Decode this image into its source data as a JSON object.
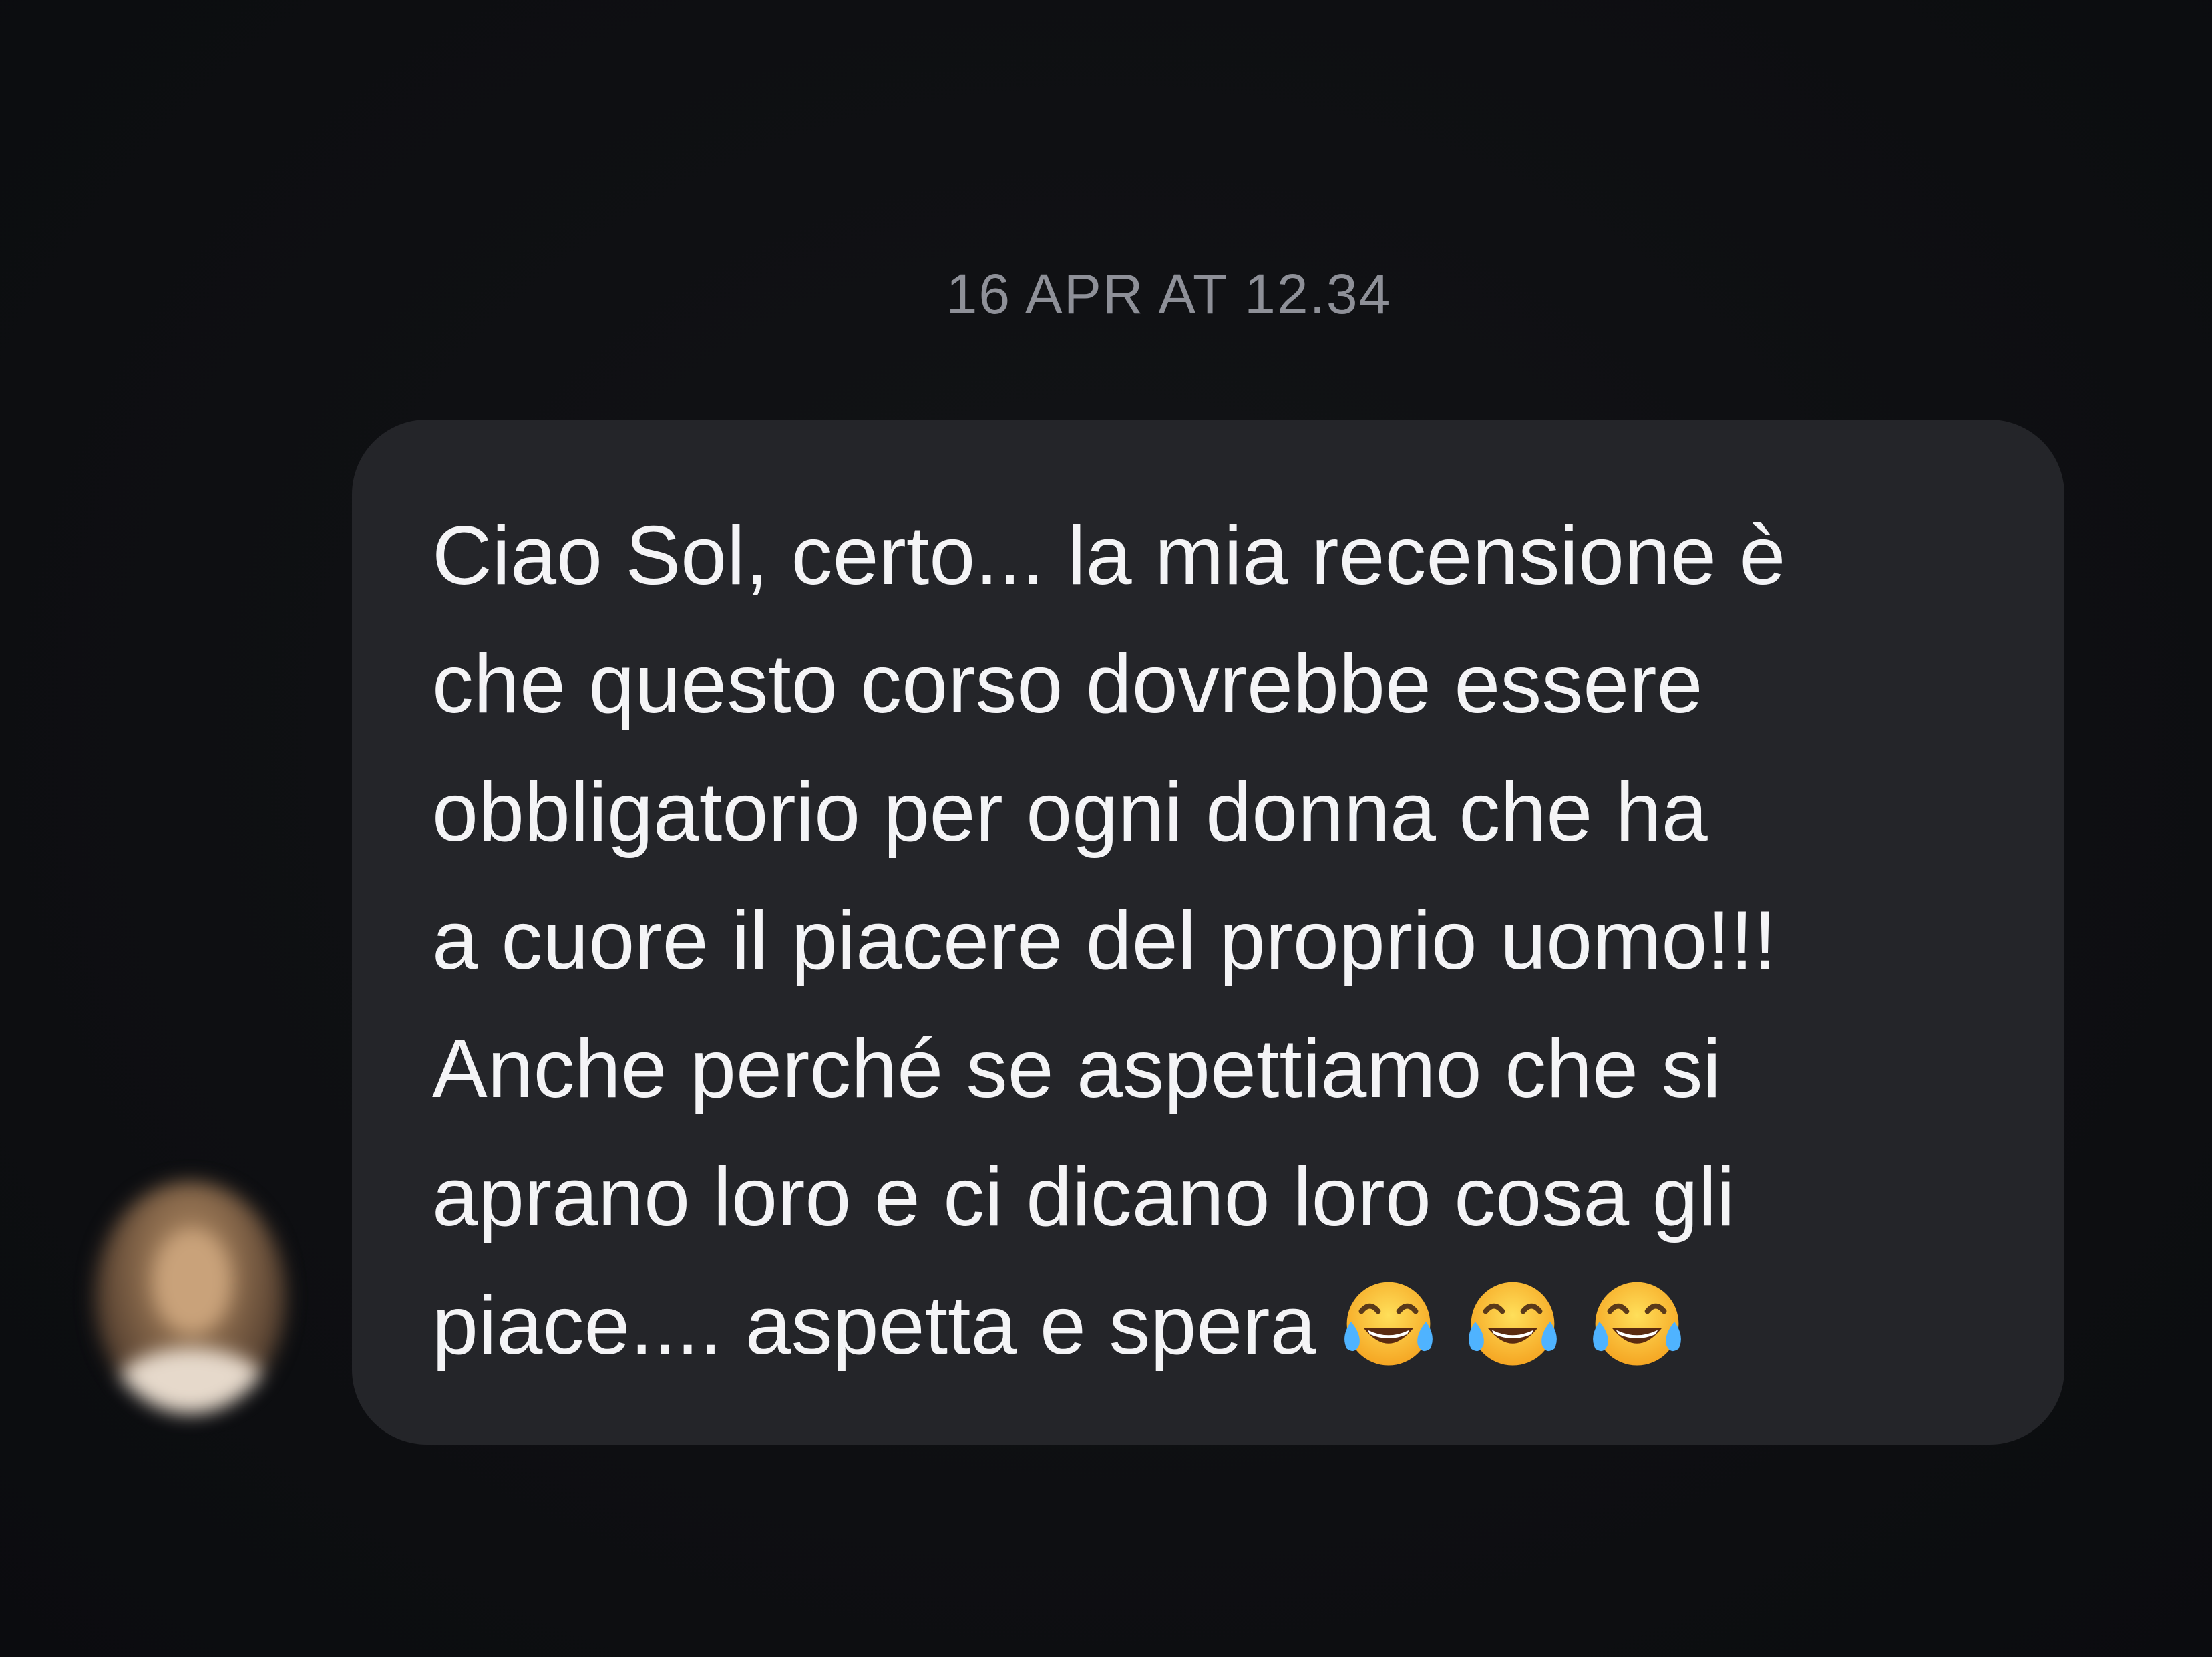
{
  "conversation": {
    "timestamp": "16 APR AT 12.34",
    "message": {
      "text": "Ciao Sol, certo... la mia recensione è\nche questo corso dovrebbe essere\nobbligatorio per ogni donna che ha\na cuore il piacere del proprio uomo!!!\nAnche perché se aspettiamo che si\naprano loro e ci dicano loro cosa gli\npiace.... aspetta e spera",
      "emojis": [
        "tears-of-joy-emoji",
        "tears-of-joy-emoji",
        "tears-of-joy-emoji"
      ]
    },
    "sender_avatar": "avatar"
  },
  "colors": {
    "background": "#0f1013",
    "bubble": "#242529",
    "text": "#f4f4f6",
    "timestamp": "#8e9098"
  }
}
